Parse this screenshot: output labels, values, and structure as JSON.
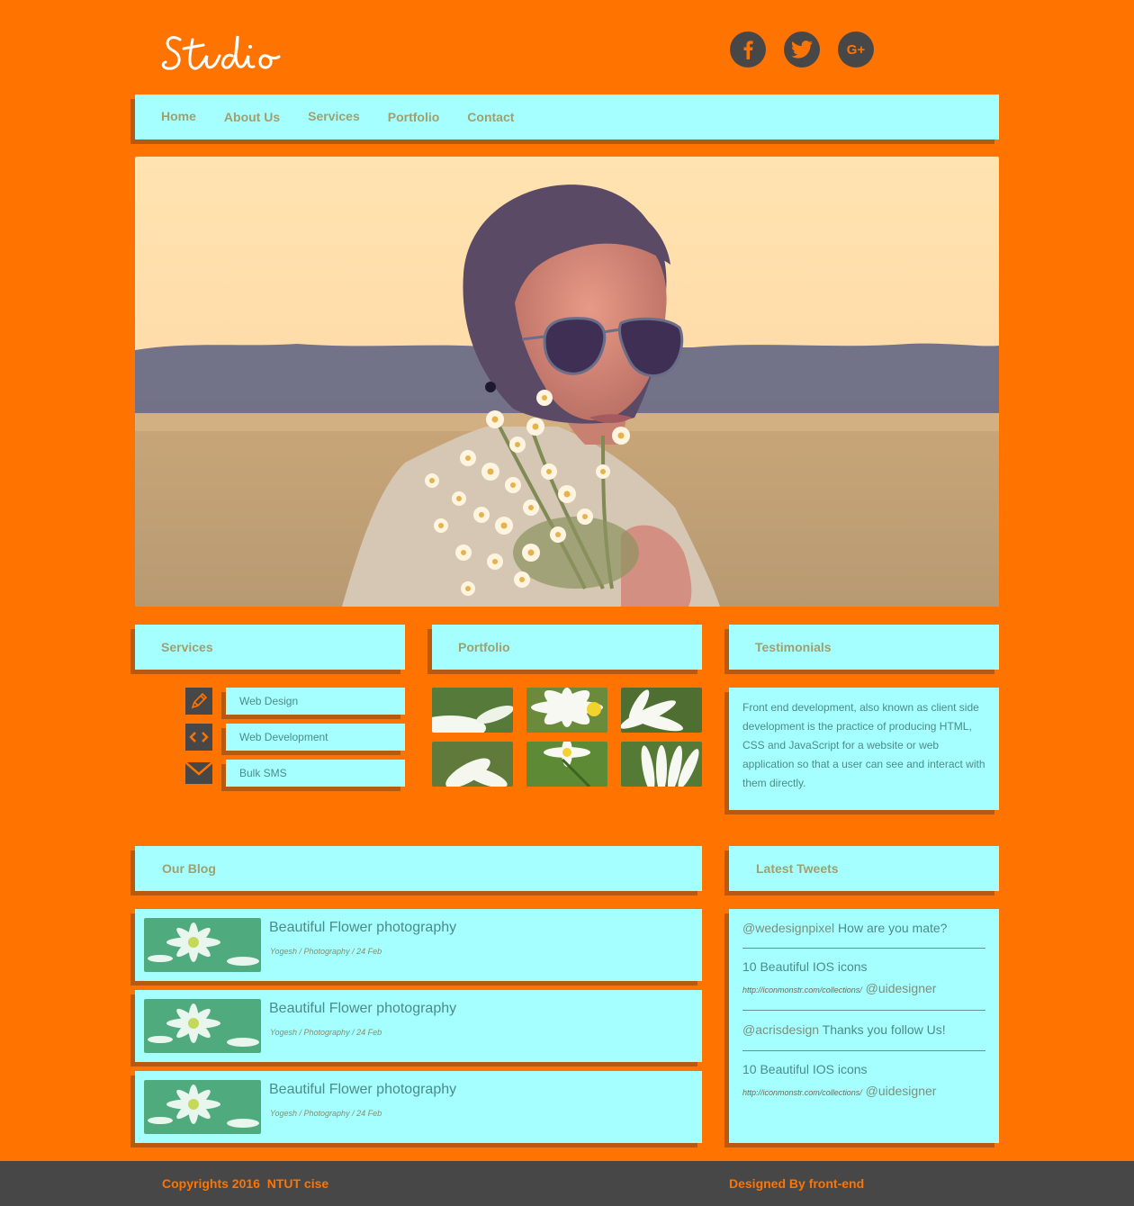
{
  "header": {
    "logo_text": "Studio",
    "social": [
      {
        "name": "facebook-icon",
        "glyph": "f"
      },
      {
        "name": "twitter-icon",
        "glyph": "t"
      },
      {
        "name": "google-plus-icon",
        "glyph": "G+"
      }
    ]
  },
  "nav": {
    "items": [
      "Home",
      "About Us",
      "Services",
      "Portfolio",
      "Contact"
    ]
  },
  "services": {
    "title": "Services",
    "items": [
      {
        "icon": "pencil-icon",
        "label": "Web Design"
      },
      {
        "icon": "code-icon",
        "label": "Web Development"
      },
      {
        "icon": "envelope-icon",
        "label": "Bulk SMS"
      }
    ]
  },
  "portfolio": {
    "title": "Portfolio"
  },
  "testimonials": {
    "title": "Testimonials",
    "text": "Front end development, also known as client side development is the practice of producing HTML, CSS and JavaScript for a website or web application so that a user can see and interact with them directly."
  },
  "blog": {
    "title": "Our Blog",
    "posts": [
      {
        "title": "Beautiful Flower photography",
        "meta": "Yogesh / Photography / 24 Feb"
      },
      {
        "title": "Beautiful Flower photography",
        "meta": "Yogesh / Photography / 24 Feb"
      },
      {
        "title": "Beautiful Flower photography",
        "meta": "Yogesh / Photography / 24 Feb"
      }
    ]
  },
  "tweets": {
    "title": "Latest Tweets",
    "items": [
      {
        "handle": "@wedesignpixel",
        "text": " How are you mate?"
      },
      {
        "text": "10 Beautiful IOS icons",
        "link": "http://iconmonstr.com/collections/",
        "handle": " @uidesigner"
      },
      {
        "handle": "@acrisdesign",
        "text": " Thanks you follow Us!"
      },
      {
        "text": "10 Beautiful IOS icons",
        "link": "http://iconmonstr.com/collections/",
        "handle": " @uidesigner"
      }
    ]
  },
  "footer": {
    "copyright": "Copyrights 2016  NTUT cise",
    "designed": "Designed By front-end"
  },
  "colors": {
    "background": "#ff7400",
    "panel": "#a6ffff",
    "dark": "#474747"
  }
}
